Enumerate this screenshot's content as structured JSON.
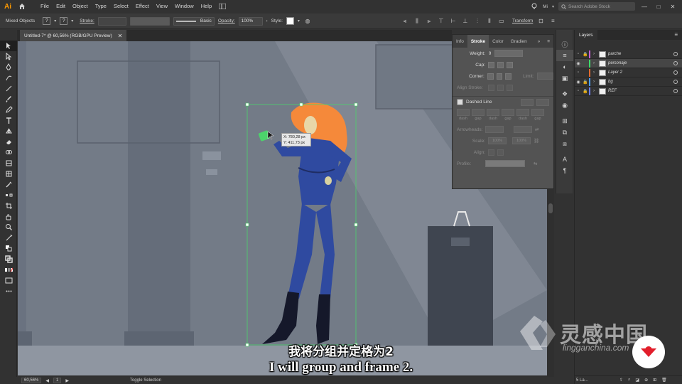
{
  "app": {
    "logo": "Ai",
    "menu": [
      "File",
      "Edit",
      "Object",
      "Type",
      "Select",
      "Effect",
      "View",
      "Window",
      "Help"
    ],
    "workspace": "Mi",
    "stock_search_placeholder": "Search Adobe Stock",
    "window_min": "—",
    "window_max": "□",
    "window_close": "✕"
  },
  "controlbar": {
    "selection": "Mixed Objects",
    "fill_symbol": "?",
    "stroke_symbol": "?",
    "stroke_label": "Stroke:",
    "brush_label": "Basic",
    "opacity_label": "Opacity:",
    "opacity_value": "100%",
    "style_label": "Style:",
    "transform_label": "Transform"
  },
  "document": {
    "tab_title": "Untitled-7* @ 60,56% (RGB/GPU Preview)",
    "close": "✕"
  },
  "canvas": {
    "tooltip_x": "X: 780,28 px",
    "tooltip_y": "Y: 411,73 px"
  },
  "statusbar": {
    "zoom": "60,56%",
    "artboard": "1",
    "mode": "Toggle Selection"
  },
  "stroke_panel": {
    "tabs": [
      "Info",
      "Stroke",
      "Color",
      "Gradien"
    ],
    "active_tab": "Stroke",
    "more": "»",
    "weight_label": "Weight:",
    "cap_label": "Cap:",
    "corner_label": "Corner:",
    "limit_label": "Limit:",
    "align_label": "Align Stroke:",
    "dashed_label": "Dashed Line",
    "dash_labels": [
      "dash",
      "gap",
      "dash",
      "gap",
      "dash",
      "gap"
    ],
    "arrowheads_label": "Arrowheads:",
    "scale_label": "Scale:",
    "scale_value_1": "100%",
    "scale_value_2": "100%",
    "align_arrow_label": "Align:",
    "profile_label": "Profile:"
  },
  "layers_panel": {
    "tab": "Layers",
    "layers": [
      {
        "name": "parche",
        "color": "#c75fd6",
        "visible": false,
        "locked": true,
        "selected": false
      },
      {
        "name": "personaje",
        "color": "#3fd96a",
        "visible": true,
        "locked": false,
        "selected": true
      },
      {
        "name": "Layer 2",
        "color": "#e36a2e",
        "visible": false,
        "locked": false,
        "selected": false
      },
      {
        "name": "bg",
        "color": "#4aa0ff",
        "visible": true,
        "locked": true,
        "selected": false
      },
      {
        "name": "REF",
        "color": "#6b7cff",
        "visible": false,
        "locked": true,
        "selected": false
      }
    ],
    "footer_count": "5 La..."
  },
  "subtitles": {
    "cn": "我将分组并定格为2",
    "en": "I will group and frame 2."
  },
  "watermark": {
    "cn": "灵感中国",
    "url": "lingganchina.com"
  },
  "colors": {
    "canvas_bg": "#737b87",
    "figure_suit": "#2f4aa0",
    "hair": "#f5893a",
    "selection": "#4cd36b",
    "accent": "#ff9a00"
  }
}
